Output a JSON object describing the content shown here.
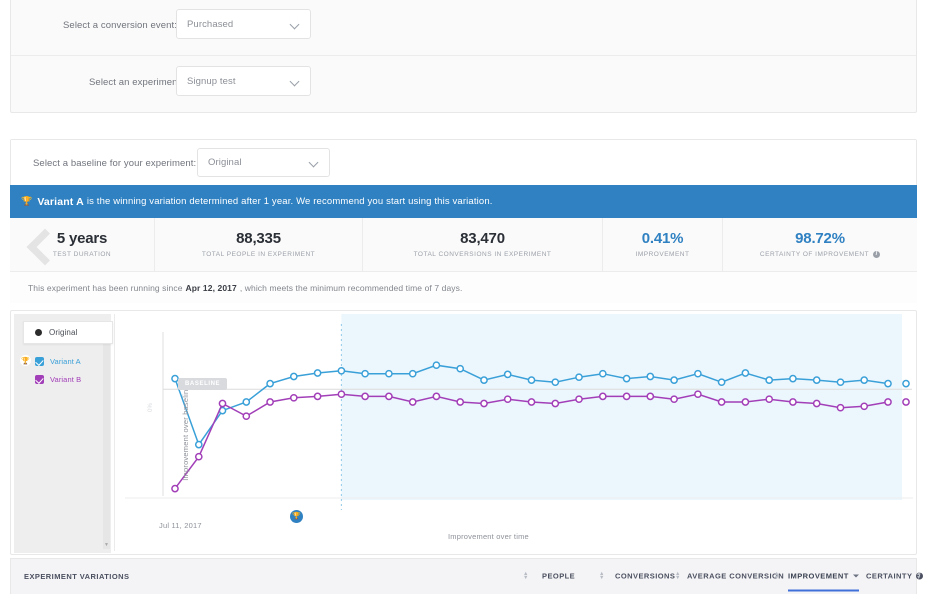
{
  "selectors": {
    "conversion_event": {
      "label": "Select a conversion event:",
      "value": "Purchased"
    },
    "experiment": {
      "label": "Select an experiment:",
      "value": "Signup test"
    },
    "baseline": {
      "label": "Select a baseline for your experiment:",
      "value": "Original"
    }
  },
  "banner": {
    "trophy_icon": "trophy-icon",
    "winner": "Variant A",
    "message": "is the winning variation determined after 1 year. We recommend you start using this variation.",
    "color": "#2f81c2"
  },
  "stats": [
    {
      "value": "5 years",
      "label": "TEST DURATION",
      "accent": false,
      "info": false
    },
    {
      "value": "88,335",
      "label": "TOTAL PEOPLE IN EXPERIMENT",
      "accent": false,
      "info": false
    },
    {
      "value": "83,470",
      "label": "TOTAL CONVERSIONS IN EXPERIMENT",
      "accent": false,
      "info": false
    },
    {
      "value": "0.41%",
      "label": "IMPROVEMENT",
      "accent": true,
      "info": false
    },
    {
      "value": "98.72%",
      "label": "CERTAINTY OF IMPROVEMENT",
      "accent": true,
      "info": true
    }
  ],
  "running_note": {
    "prefix": "This experiment has been running since",
    "date": "Apr 12, 2017",
    "suffix": ", which meets the minimum recommended time of 7 days."
  },
  "legend": {
    "tooltip": {
      "name": "Original",
      "color": "#2c2c2c"
    },
    "items": [
      {
        "label": "Variant A",
        "color": "#3aa0d8",
        "checked": true,
        "winner": true
      },
      {
        "label": "Variant B",
        "color": "#a23fb8",
        "checked": true,
        "winner": false
      }
    ]
  },
  "chart_data": {
    "type": "line",
    "title": "Improvement over time",
    "xlabel": "",
    "ylabel": "Improvement over baseline",
    "baseline_label": "BASELINE",
    "x_tick_labels": [
      "Jul 11, 2017"
    ],
    "y_tick_labels": [
      "0%"
    ],
    "grid": false,
    "legend_position": "left",
    "winner_marker": {
      "icon": "trophy-icon",
      "x_index": 7,
      "color": "#2f81c2"
    },
    "highlight_band": {
      "from_index": 7,
      "to_index": 45,
      "color": "#ddeefb"
    },
    "series": [
      {
        "name": "Variant A",
        "color": "#3aa0d8",
        "values": [
          1.55,
          0.62,
          1.1,
          1.22,
          1.48,
          1.58,
          1.63,
          1.66,
          1.62,
          1.62,
          1.62,
          1.74,
          1.69,
          1.53,
          1.61,
          1.53,
          1.5,
          1.57,
          1.62,
          1.55,
          1.58,
          1.53,
          1.62,
          1.5,
          1.63,
          1.53,
          1.55,
          1.53,
          1.5,
          1.53,
          1.48
        ]
      },
      {
        "name": "Variant B",
        "color": "#a23fb8",
        "values": [
          0.0,
          0.45,
          1.2,
          1.02,
          1.22,
          1.28,
          1.3,
          1.33,
          1.3,
          1.3,
          1.22,
          1.3,
          1.22,
          1.2,
          1.26,
          1.22,
          1.2,
          1.26,
          1.3,
          1.3,
          1.3,
          1.26,
          1.33,
          1.22,
          1.22,
          1.26,
          1.22,
          1.2,
          1.14,
          1.16,
          1.22
        ]
      }
    ]
  },
  "footer": {
    "variations_label": "EXPERIMENT VARIATIONS",
    "columns": [
      {
        "label": "PEOPLE",
        "active": false,
        "info": false
      },
      {
        "label": "CONVERSIONS",
        "active": false,
        "info": false
      },
      {
        "label": "AVERAGE CONVERSION",
        "active": false,
        "info": false
      },
      {
        "label": "IMPROVEMENT",
        "active": true,
        "info": false
      },
      {
        "label": "CERTAINTY",
        "active": false,
        "info": true
      }
    ]
  }
}
